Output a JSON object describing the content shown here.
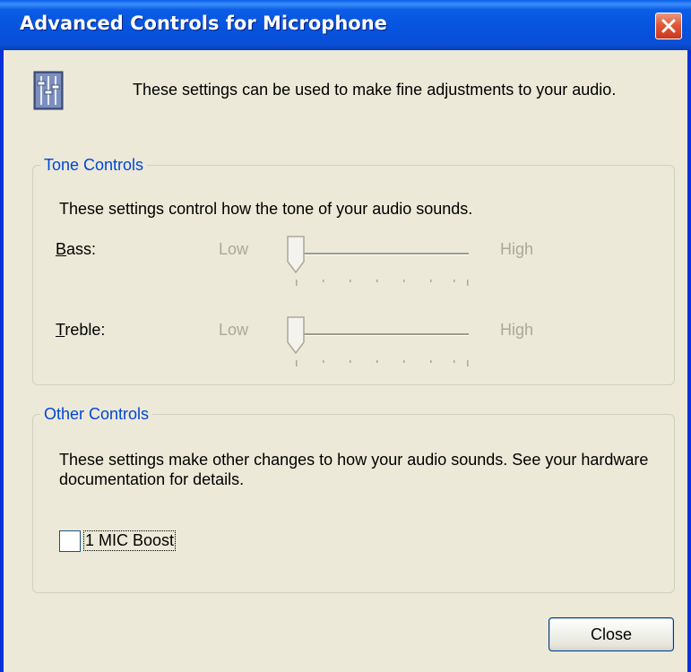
{
  "window": {
    "title": "Advanced Controls for Microphone"
  },
  "header": {
    "description": "These settings can be used to make fine adjustments to your audio."
  },
  "tone_controls": {
    "legend": "Tone Controls",
    "description": "These settings control how the tone of your audio sounds.",
    "bass": {
      "label_accel": "B",
      "label_rest": "ass:",
      "low_label": "Low",
      "high_label": "High",
      "level": 0,
      "enabled": false
    },
    "treble": {
      "label_accel": "T",
      "label_rest": "reble:",
      "low_label": "Low",
      "high_label": "High",
      "level": 0,
      "enabled": false
    }
  },
  "other_controls": {
    "legend": "Other Controls",
    "description": "These settings make other changes to how your audio sounds.  See your hardware documentation for details.",
    "mic_boost": {
      "label": "1  MIC Boost",
      "checked": false
    }
  },
  "buttons": {
    "close_label": "Close"
  },
  "colors": {
    "titlebar": "#0A5EE8",
    "legend_text": "#0046D5",
    "disabled_text": "#ACA899",
    "face": "#ECE9D8"
  },
  "icons": {
    "title_close": "close-icon",
    "header": "mixer-settings-icon"
  }
}
